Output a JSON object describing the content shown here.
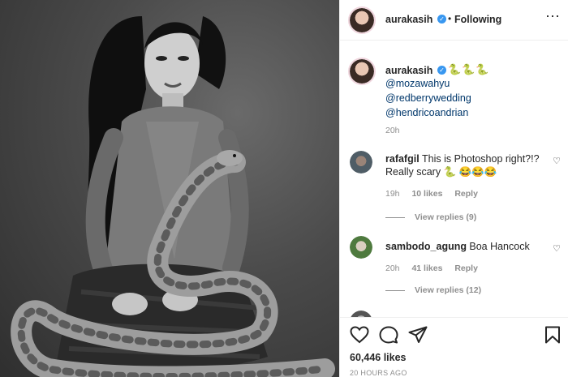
{
  "post": {
    "author": "aurakasih",
    "follow_dot": "•",
    "follow_status": "Following",
    "more_icon": "more-horizontal-icon",
    "verified_icon": "verified-badge-icon"
  },
  "caption": {
    "username": "aurakasih",
    "emoji": "🐍🐍🐍",
    "mentions": [
      "@mozawahyu",
      "@redberrywedding",
      "@hendricoandrian"
    ],
    "time": "20h"
  },
  "comments": [
    {
      "username": "rafafgil",
      "text": "This is Photoshop right?!? Really scary 🐍 😂😂😂",
      "time": "19h",
      "likes": "10 likes",
      "reply": "Reply",
      "view_replies": "View replies (9)"
    },
    {
      "username": "sambodo_agung",
      "text": "Boa Hancock",
      "time": "20h",
      "likes": "41 likes",
      "reply": "Reply",
      "view_replies": "View replies (12)"
    }
  ],
  "actions": {
    "icons": [
      "heart-icon",
      "comment-icon",
      "share-icon",
      "bookmark-icon"
    ]
  },
  "likes": "60,446 likes",
  "posted": "20 HOURS AGO",
  "colors": {
    "verified": "#3897f0",
    "mention": "#00376b",
    "secondary_text": "#8e8e8e",
    "border": "#efefef"
  }
}
